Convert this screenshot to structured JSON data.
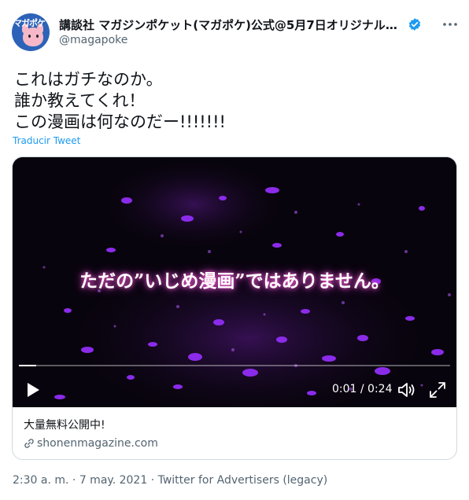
{
  "author": {
    "display_name": "講談社 マガジンポケット(マガポケ)公式@5月7日オリジナル単…",
    "handle": "@magapoke",
    "avatar_text": "マガポケ",
    "verified_icon": "verified-badge-icon"
  },
  "tweet": {
    "text": "これはガチなのか。\n誰か教えてくれ！\nこの漫画は何なのだー!!!!!!!",
    "translate_label": "Traducir Tweet"
  },
  "media": {
    "caption": "ただの”いじめ漫画”ではありません。",
    "time_display": "0:01 / 0:24",
    "progress": 0.04,
    "accent_color": "#9b30ff"
  },
  "card": {
    "title": "大量無料公開中!",
    "domain": "shonenmagazine.com"
  },
  "meta": {
    "time": "2:30 a. m.",
    "separator": "·",
    "date": "7 may. 2021",
    "source": "Twitter for Advertisers (legacy)"
  },
  "colors": {
    "link": "#1d9bf0",
    "secondary_text": "#536471",
    "verified": "#1d9bf0"
  }
}
